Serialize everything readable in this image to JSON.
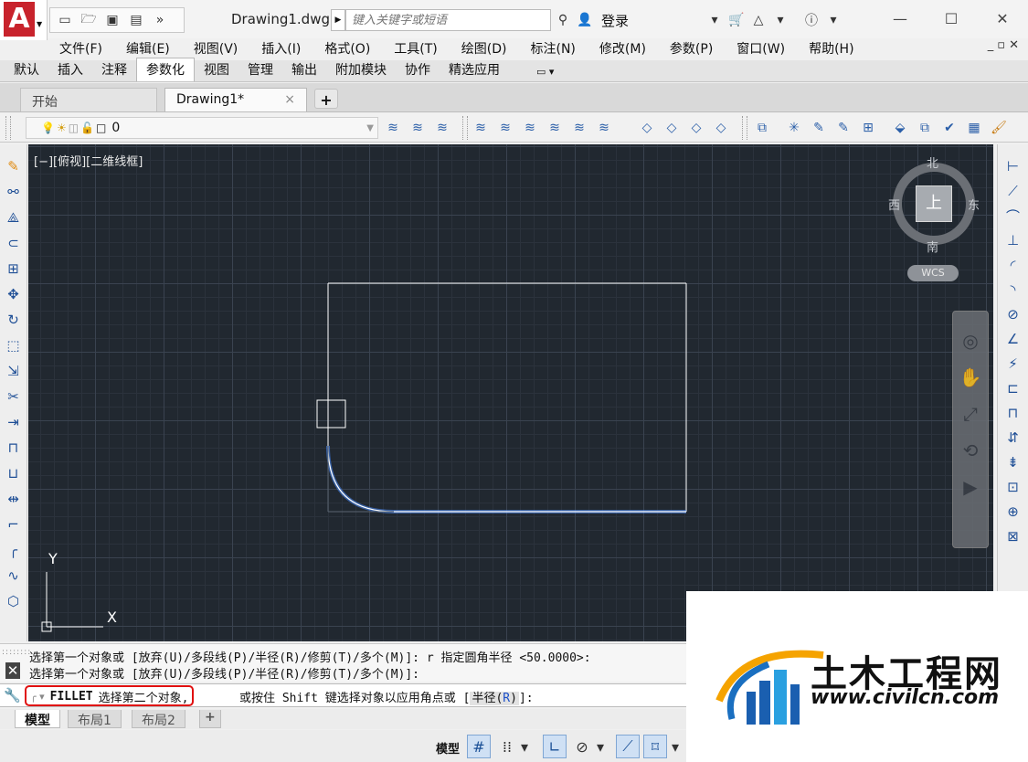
{
  "app": {
    "document_title": "Drawing1.dwg",
    "search_placeholder": "键入关键字或短语",
    "login_label": "登录"
  },
  "menu": [
    "文件(F)",
    "编辑(E)",
    "视图(V)",
    "插入(I)",
    "格式(O)",
    "工具(T)",
    "绘图(D)",
    "标注(N)",
    "修改(M)",
    "参数(P)",
    "窗口(W)",
    "帮助(H)"
  ],
  "ribbon_tabs": {
    "items": [
      "默认",
      "插入",
      "注释",
      "参数化",
      "视图",
      "管理",
      "输出",
      "附加模块",
      "协作",
      "精选应用"
    ],
    "active": "参数化"
  },
  "doc_tabs": {
    "start": "开始",
    "drawing": "Drawing1*",
    "close": "×",
    "add": "+"
  },
  "layer": {
    "name": "0"
  },
  "viewport": {
    "label": "[−][俯视][二维线框]"
  },
  "viewcube": {
    "top": "上",
    "north": "北",
    "south": "南",
    "west": "西",
    "east": "东",
    "wcs": "WCS"
  },
  "ucs": {
    "x": "X",
    "y": "Y"
  },
  "command": {
    "history": [
      "选择第一个对象或 [放弃(U)/多段线(P)/半径(R)/修剪(T)/多个(M)]: r 指定圆角半径 <50.0000>:",
      "选择第一个对象或 [放弃(U)/多段线(P)/半径(R)/修剪(T)/多个(M)]:"
    ],
    "name": "FILLET",
    "prompt": "选择第二个对象,",
    "rest": "或按住 Shift 键选择对象以应用角点或 [",
    "option_label": "半径(",
    "option_key": "R",
    "option_close": ")",
    "tail": "]:"
  },
  "layout_tabs": {
    "model": "模型",
    "layout1": "布局1",
    "layout2": "布局2",
    "add": "+"
  },
  "status": {
    "model": "模型"
  },
  "watermark": {
    "title": "土木工程网",
    "url": "www.civilcn.com"
  },
  "colors": {
    "canvas_bg": "#212830",
    "geometry": "#ffffff",
    "selected_highlight": "#4a8cff",
    "prompt_border": "#e01010"
  }
}
